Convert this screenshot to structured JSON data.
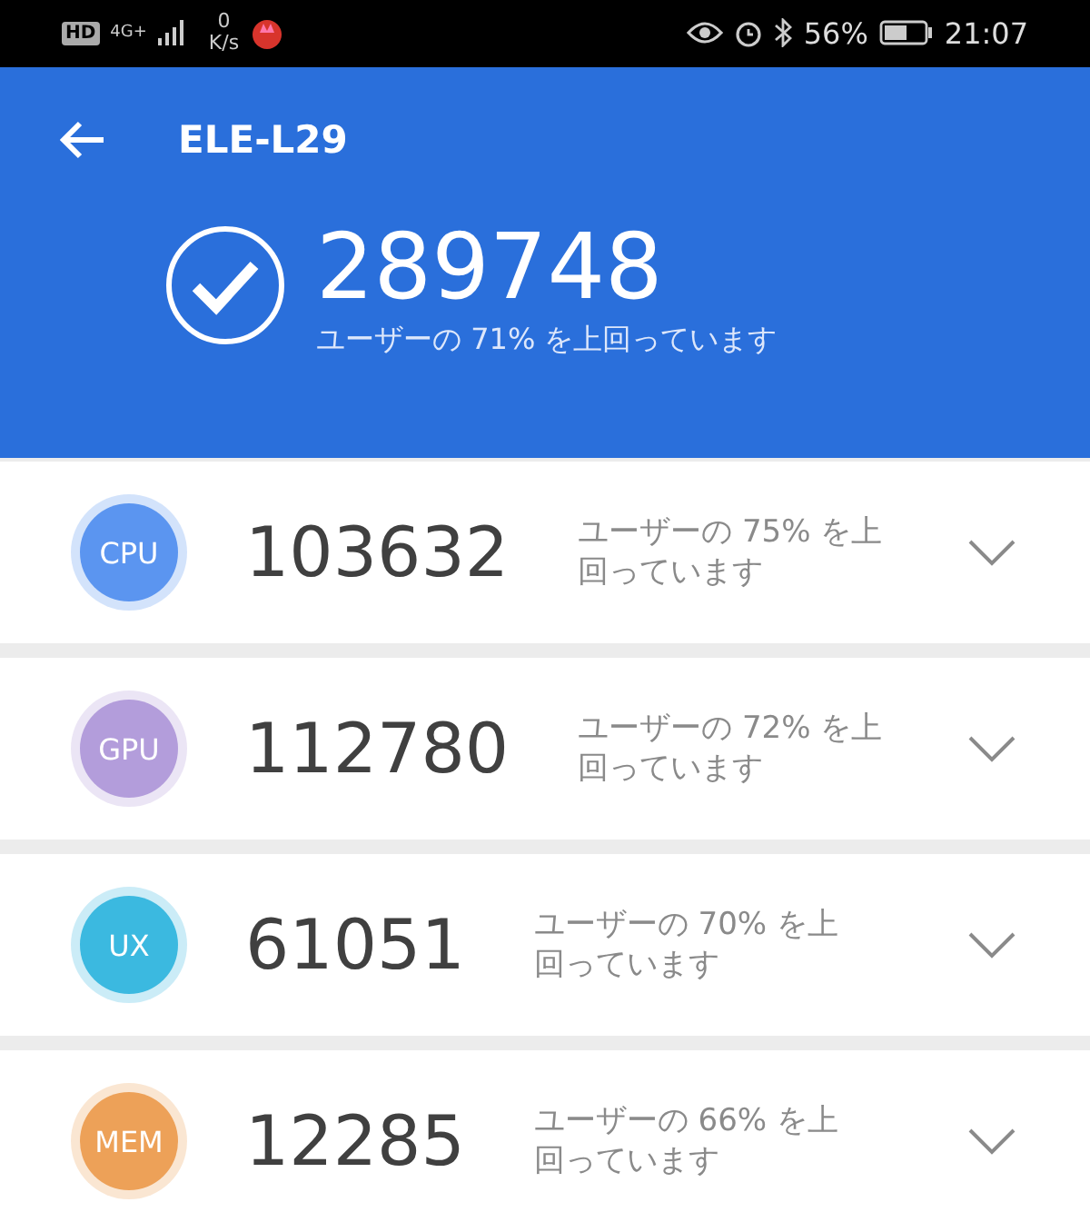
{
  "status_bar": {
    "hd": "HD",
    "network": "4G+",
    "speed_value": "0",
    "speed_unit": "K/s",
    "battery": "56%",
    "time": "21:07"
  },
  "header": {
    "title": "ELE-L29",
    "score": "289748",
    "subtitle": "ユーザーの 71% を上回っています"
  },
  "results": [
    {
      "label": "CPU",
      "score": "103632",
      "description": "ユーザーの 75% を上回っています",
      "color": "#5b95f0"
    },
    {
      "label": "GPU",
      "score": "112780",
      "description": "ユーザーの 72% を上回っています",
      "color": "#b39ddb"
    },
    {
      "label": "UX",
      "score": "61051",
      "description": "ユーザーの 70% を上回っています",
      "color": "#3bb9e0"
    },
    {
      "label": "MEM",
      "score": "12285",
      "description": "ユーザーの 66% を上回っています",
      "color": "#eda158"
    }
  ]
}
